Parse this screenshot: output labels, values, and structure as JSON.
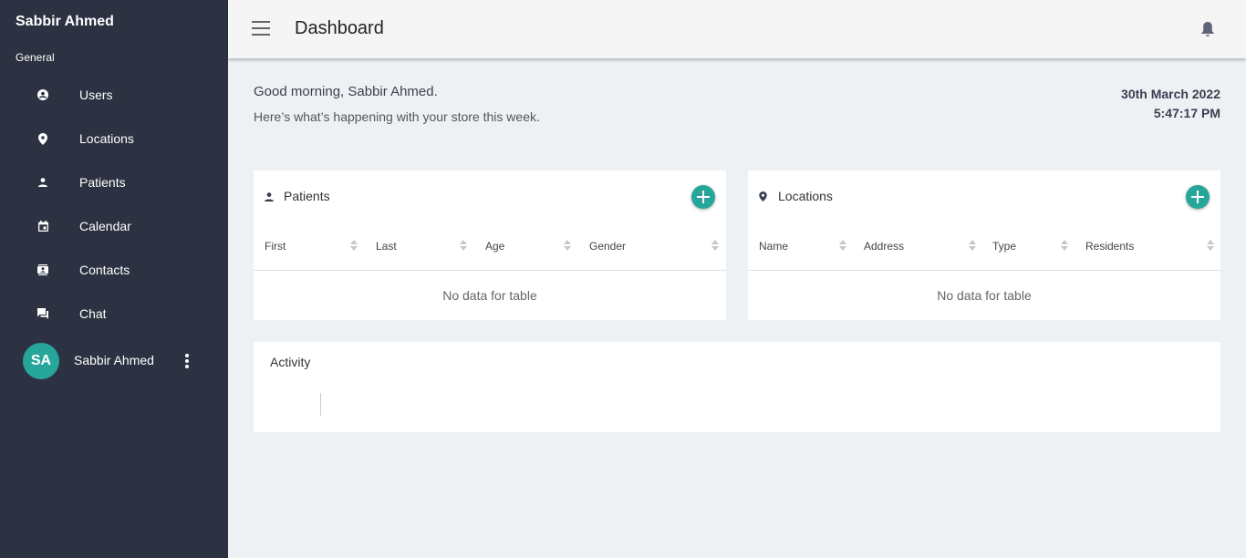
{
  "sidebar": {
    "brand": "Sabbir Ahmed",
    "section": "General",
    "items": [
      {
        "label": "Users",
        "icon": "account-circle-icon"
      },
      {
        "label": "Locations",
        "icon": "map-pin-icon"
      },
      {
        "label": "Patients",
        "icon": "person-icon"
      },
      {
        "label": "Calendar",
        "icon": "calendar-icon"
      },
      {
        "label": "Contacts",
        "icon": "contacts-icon"
      },
      {
        "label": "Chat",
        "icon": "chat-icon"
      }
    ],
    "user": {
      "initials": "SA",
      "name": "Sabbir Ahmed"
    }
  },
  "header": {
    "title": "Dashboard"
  },
  "greeting": {
    "title": "Good morning, Sabbir Ahmed.",
    "subtitle": "Here’s what’s happening with your store this week.",
    "date": "30th March 2022",
    "time": "5:47:17 PM"
  },
  "patients": {
    "title": "Patients",
    "columns": [
      "First",
      "Last",
      "Age",
      "Gender"
    ],
    "empty": "No data for table"
  },
  "locations": {
    "title": "Locations",
    "columns": [
      "Name",
      "Address",
      "Type",
      "Residents"
    ],
    "empty": "No data for table"
  },
  "activity": {
    "title": "Activity"
  },
  "colors": {
    "sidebar": "#2d3242",
    "accent": "#26a69a",
    "background": "#eef1f4"
  }
}
